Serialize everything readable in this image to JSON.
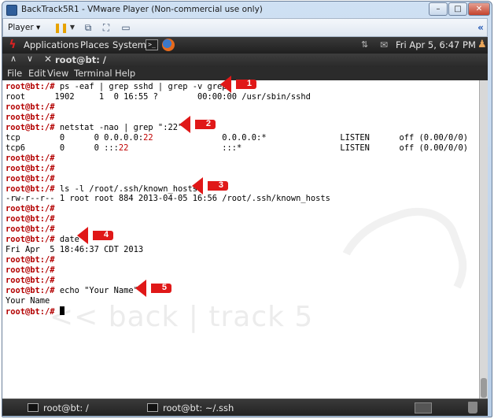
{
  "vmware": {
    "title": "BackTrack5R1 - VMware Player (Non-commercial use only)",
    "min_label": "–",
    "max_label": "□",
    "close_label": "✕",
    "player_menu": "Player ▾"
  },
  "gnome_panel": {
    "menus": [
      "Applications",
      "Places",
      "System"
    ],
    "clock": "Fri Apr  5,  6:47 PM"
  },
  "terminal": {
    "title": "root@bt: /",
    "menus": [
      "File",
      "Edit",
      "View",
      "Terminal",
      "Help"
    ],
    "prompt": "root@bt:/#",
    "watermark": "<< back | track 5",
    "lines": [
      {
        "type": "prompt",
        "cmd": " ps -eaf | grep sshd | grep -v grep"
      },
      {
        "type": "output",
        "text": "root      1902     1  0 16:55 ?        00:00:00 /usr/sbin/sshd"
      },
      {
        "type": "prompt",
        "cmd": ""
      },
      {
        "type": "prompt",
        "cmd": ""
      },
      {
        "type": "prompt",
        "cmd": " netstat -nao | grep \":22\""
      },
      {
        "type": "output_hl",
        "pre": "tcp        0      0 0.0.0.0:",
        "hl": "22",
        "post": "              0.0.0.0:*               LISTEN      off (0.00/0/0)"
      },
      {
        "type": "output_hl",
        "pre": "tcp6       0      0 :::",
        "hl": "22",
        "post": "                   :::*                    LISTEN      off (0.00/0/0)"
      },
      {
        "type": "prompt",
        "cmd": ""
      },
      {
        "type": "prompt",
        "cmd": ""
      },
      {
        "type": "prompt",
        "cmd": ""
      },
      {
        "type": "prompt",
        "cmd": " ls -l /root/.ssh/known_hosts"
      },
      {
        "type": "output",
        "text": "-rw-r--r-- 1 root root 884 2013-04-05 16:56 /root/.ssh/known_hosts"
      },
      {
        "type": "prompt",
        "cmd": ""
      },
      {
        "type": "prompt",
        "cmd": ""
      },
      {
        "type": "prompt",
        "cmd": ""
      },
      {
        "type": "prompt",
        "cmd": " date"
      },
      {
        "type": "output",
        "text": "Fri Apr  5 18:46:37 CDT 2013"
      },
      {
        "type": "prompt",
        "cmd": ""
      },
      {
        "type": "prompt",
        "cmd": ""
      },
      {
        "type": "prompt",
        "cmd": ""
      },
      {
        "type": "prompt",
        "cmd": " echo \"Your Name\""
      },
      {
        "type": "output",
        "text": "Your Name"
      },
      {
        "type": "prompt_cursor",
        "cmd": " "
      }
    ]
  },
  "annotations": [
    "1",
    "2",
    "3",
    "4",
    "5"
  ],
  "taskbar": {
    "tasks": [
      "root@bt: /",
      "root@bt: ~/.ssh"
    ]
  },
  "colors": {
    "prompt": "#b30000",
    "arrow": "#e01818",
    "port_highlight": "#c00000"
  }
}
